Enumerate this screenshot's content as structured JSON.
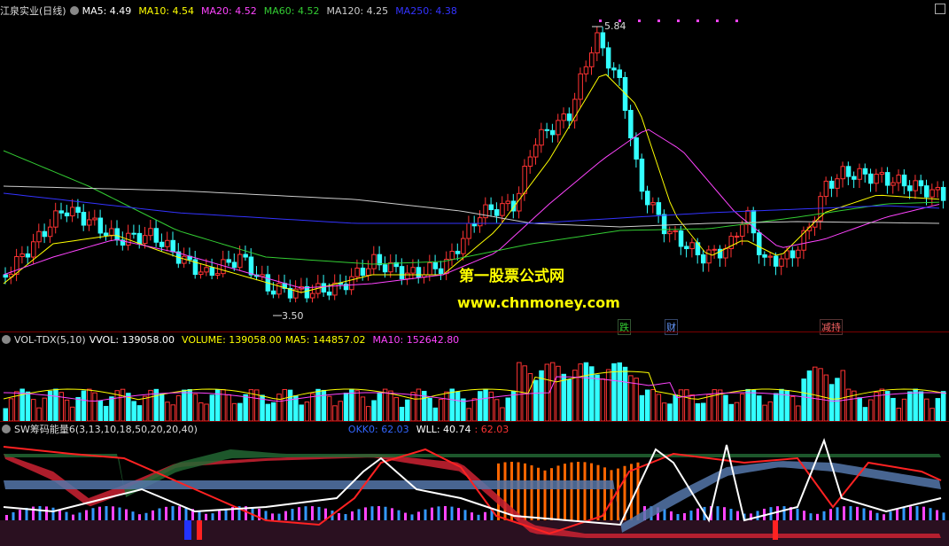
{
  "main": {
    "title": "江泉实业(日线)",
    "ma_labels": [
      {
        "text": "MA5: 4.49",
        "color": "#ffffff"
      },
      {
        "text": "MA10: 4.54",
        "color": "#ffff00"
      },
      {
        "text": "MA20: 4.52",
        "color": "#ff44ff"
      },
      {
        "text": "MA60: 4.52",
        "color": "#33cc33"
      },
      {
        "text": "MA120: 4.25",
        "color": "#cccccc"
      },
      {
        "text": "MA250: 4.38",
        "color": "#3333ff"
      }
    ],
    "high_label": "5.84",
    "low_label": "3.50",
    "event_tags": [
      {
        "text": "跌",
        "color": "#33cc33"
      },
      {
        "text": "财",
        "color": "#6699ff"
      },
      {
        "text": "减持",
        "color": "#ff6666"
      }
    ],
    "watermark_cn": "第一股票公式网",
    "watermark_url": "www.chnmoney.com"
  },
  "volume": {
    "labels": [
      {
        "text": "VOL-TDX(5,10)",
        "color": "#dddddd"
      },
      {
        "text": "VVOL: 139058.00",
        "color": "#ffffff"
      },
      {
        "text": "VOLUME: 139058.00",
        "color": "#ffff00"
      },
      {
        "text": "MA5: 144857.02",
        "color": "#ffff00"
      },
      {
        "text": "MA10: 152642.80",
        "color": "#ff44ff"
      }
    ]
  },
  "indicator": {
    "labels": [
      {
        "text": "SW筹码能量6(3,13,10,18,50,20,20,40)",
        "color": "#dddddd"
      },
      {
        "text": "OKK0: 62.03",
        "color": "#3366ff"
      },
      {
        "text": "WLL: 40.74",
        "color": "#ffffff"
      },
      {
        "text": ": 62.03",
        "color": "#ff3333"
      }
    ]
  },
  "icons": {
    "settings": "settings-toggle-icon",
    "corner": "close-box-icon"
  }
}
